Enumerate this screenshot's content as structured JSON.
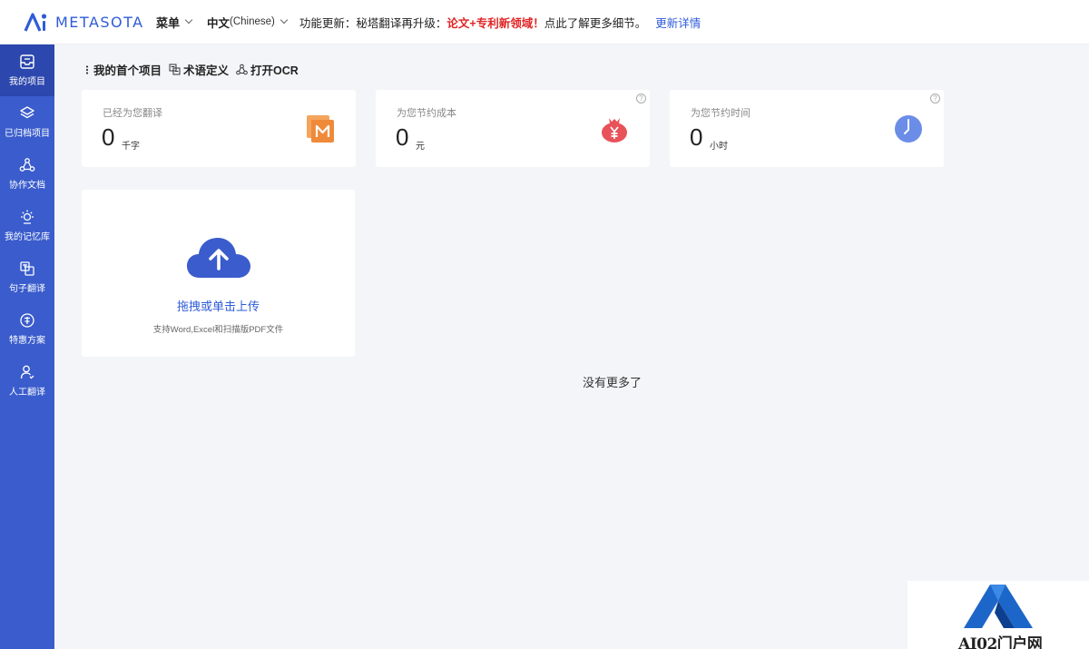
{
  "brand": {
    "name": "METASOTA",
    "color": "#2e5bd8"
  },
  "header": {
    "menu_label": "菜单",
    "lang_label": "中文",
    "lang_sub": "(Chinese)",
    "notice_prefix": "功能更新：秘塔翻译再升级：",
    "notice_highlight": "论文+专利新领域！",
    "notice_suffix": "点此了解更多细节。",
    "notice_link": "更新详情"
  },
  "sidebar": {
    "items": [
      {
        "label": "我的项目",
        "icon": "inbox-icon",
        "active": true
      },
      {
        "label": "已归档项目",
        "icon": "layers-icon"
      },
      {
        "label": "协作文档",
        "icon": "collaborate-icon"
      },
      {
        "label": "我的记忆库",
        "icon": "bulb-icon"
      },
      {
        "label": "句子翻译",
        "icon": "translate-icon"
      },
      {
        "label": "特惠方案",
        "icon": "discount-icon"
      },
      {
        "label": "人工翻译",
        "icon": "person-icon"
      }
    ]
  },
  "toolbar": {
    "project_label": "我的首个项目",
    "terms_label": "术语定义",
    "ocr_label": "打开OCR"
  },
  "stats": [
    {
      "title": "已经为您翻译",
      "value": "0",
      "unit": "千字",
      "icon": "m-badge-icon"
    },
    {
      "title": "为您节约成本",
      "value": "0",
      "unit": "元",
      "icon": "money-bag-icon"
    },
    {
      "title": "为您节约时间",
      "value": "0",
      "unit": "小时",
      "icon": "clock-icon"
    }
  ],
  "help_glyph": "?",
  "upload": {
    "label": "拖拽或单击上传",
    "hint": "支持Word,Excel和扫描版PDF文件"
  },
  "empty_text": "没有更多了",
  "watermark": {
    "text": "AI02门户网"
  },
  "colors": {
    "sidebar": "#3a5ccc",
    "sidebar_active": "#2c47ad",
    "accent": "#2e5bd8",
    "highlight": "#e02424"
  }
}
